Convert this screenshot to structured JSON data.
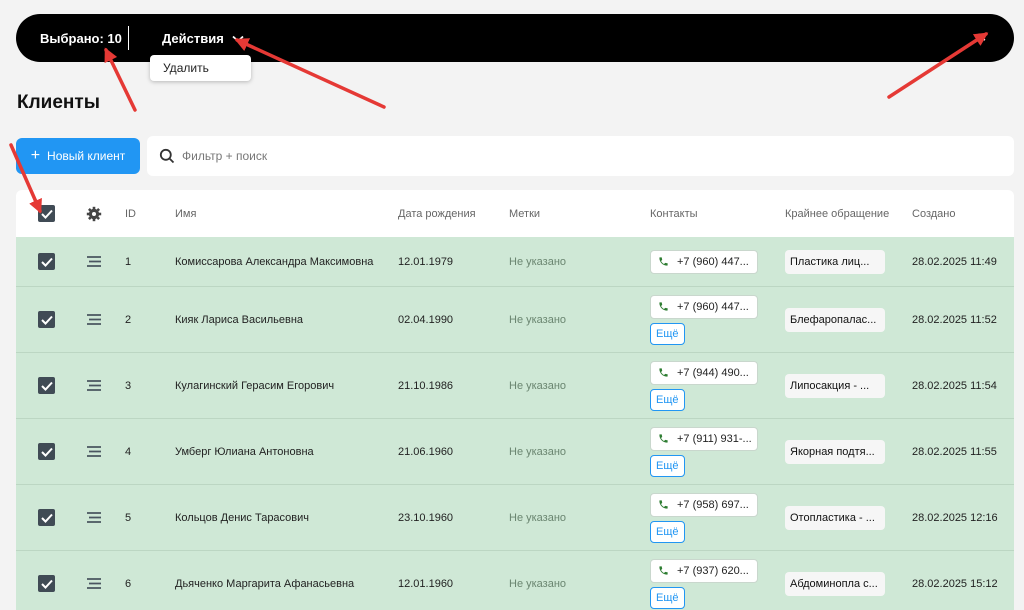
{
  "selection_bar": {
    "selected_label": "Выбрано: 10",
    "actions_label": "Действия",
    "close_label": "×",
    "dropdown": {
      "items": [
        {
          "label": "Удалить"
        }
      ]
    }
  },
  "page": {
    "title": "Клиенты"
  },
  "toolbar": {
    "new_button_plus": "+",
    "new_button_label": "Новый клиент",
    "search_placeholder": "Фильтр + поиск"
  },
  "table": {
    "columns": {
      "id": "ID",
      "name": "Имя",
      "birth": "Дата рождения",
      "tags": "Метки",
      "contacts": "Контакты",
      "last_request": "Крайнее обращение",
      "created": "Создано"
    },
    "more_label": "Ещё",
    "rows": [
      {
        "id": "1",
        "name": "Комиссарова Александра Максимовна",
        "birth": "12.01.1979",
        "tags": "Не указано",
        "phone": "+7 (960) 447...",
        "last": "Пластика лиц...",
        "created": "28.02.2025 11:49"
      },
      {
        "id": "2",
        "name": "Кияк Лариса Васильевна",
        "birth": "02.04.1990",
        "tags": "Не указано",
        "phone": "+7 (960) 447...",
        "last": "Блефаропалас...",
        "created": "28.02.2025 11:52"
      },
      {
        "id": "3",
        "name": "Кулагинский Герасим Егорович",
        "birth": "21.10.1986",
        "tags": "Не указано",
        "phone": "+7 (944) 490...",
        "last": "Липосакция - ...",
        "created": "28.02.2025 11:54"
      },
      {
        "id": "4",
        "name": "Умберг Юлиана Антоновна",
        "birth": "21.06.1960",
        "tags": "Не указано",
        "phone": "+7 (911) 931-...",
        "last": "Якорная подтя...",
        "created": "28.02.2025 11:55"
      },
      {
        "id": "5",
        "name": "Кольцов Денис Тарасович",
        "birth": "23.10.1960",
        "tags": "Не указано",
        "phone": "+7 (958) 697...",
        "last": "Отопластика - ...",
        "created": "28.02.2025 12:16"
      },
      {
        "id": "6",
        "name": "Дьяченко Маргарита Афанасьевна",
        "birth": "12.01.1960",
        "tags": "Не указано",
        "phone": "+7 (937) 620...",
        "last": "Абдоминопла с...",
        "created": "28.02.2025 15:12"
      }
    ]
  },
  "colors": {
    "accent": "#2196f3",
    "selected_row": "#cfe8d6",
    "topbar": "#000000",
    "annotation_arrow": "#e53935"
  },
  "icons": [
    "chevron-down-icon",
    "close-icon",
    "plus-icon",
    "search-icon",
    "checkbox-checked-icon",
    "gear-icon",
    "drag-handle-icon",
    "phone-icon"
  ]
}
